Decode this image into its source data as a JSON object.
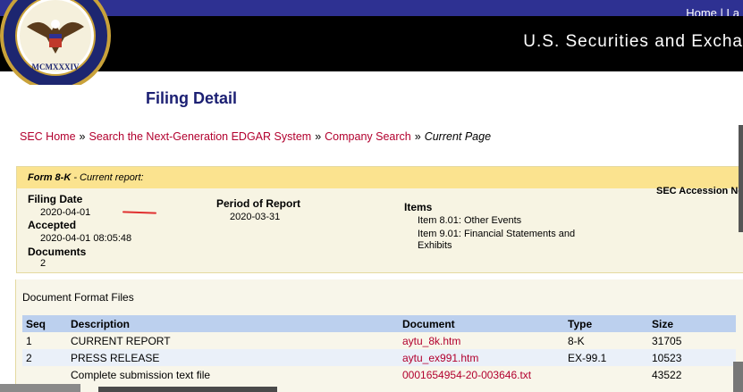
{
  "header": {
    "links": [
      "Home",
      "La"
    ],
    "banner_title": "U.S. Securities and Excha",
    "seal_text": "U.S. SECURITIES AND EXCHANGE COMMISSION MCMXXXIV"
  },
  "page_title": "Filing Detail",
  "breadcrumb": {
    "items": [
      "SEC Home",
      "Search the Next-Generation EDGAR System",
      "Company Search"
    ],
    "separator": "»",
    "current": "Current Page"
  },
  "filing": {
    "form_label": "Form 8-K",
    "form_desc": " - Current report:",
    "accession_label": "SEC Accession No",
    "filing_date_label": "Filing Date",
    "filing_date": "2020-04-01",
    "accepted_label": "Accepted",
    "accepted": "2020-04-01 08:05:48",
    "documents_label": "Documents",
    "documents": "2",
    "period_label": "Period of Report",
    "period": "2020-03-31",
    "items_label": "Items",
    "items": [
      "Item 8.01: Other Events",
      "Item 9.01: Financial Statements and",
      "Exhibits"
    ]
  },
  "doc_files": {
    "caption": "Document Format Files",
    "columns": [
      "Seq",
      "Description",
      "Document",
      "Type",
      "Size"
    ],
    "rows": [
      {
        "seq": "1",
        "description": "CURRENT REPORT",
        "document": "aytu_8k.htm",
        "type": "8-K",
        "size": "31705"
      },
      {
        "seq": "2",
        "description": "PRESS RELEASE",
        "document": "aytu_ex991.htm",
        "type": "EX-99.1",
        "size": "10523"
      },
      {
        "seq": "",
        "description": "Complete submission text file",
        "document": "0001654954-20-003646.txt",
        "type": "",
        "size": "43522"
      }
    ]
  },
  "colors": {
    "header_blue": "#2e3192",
    "link_red": "#b2002e",
    "table_header": "#bcd0ee",
    "form_strip": "#fbe38f"
  }
}
